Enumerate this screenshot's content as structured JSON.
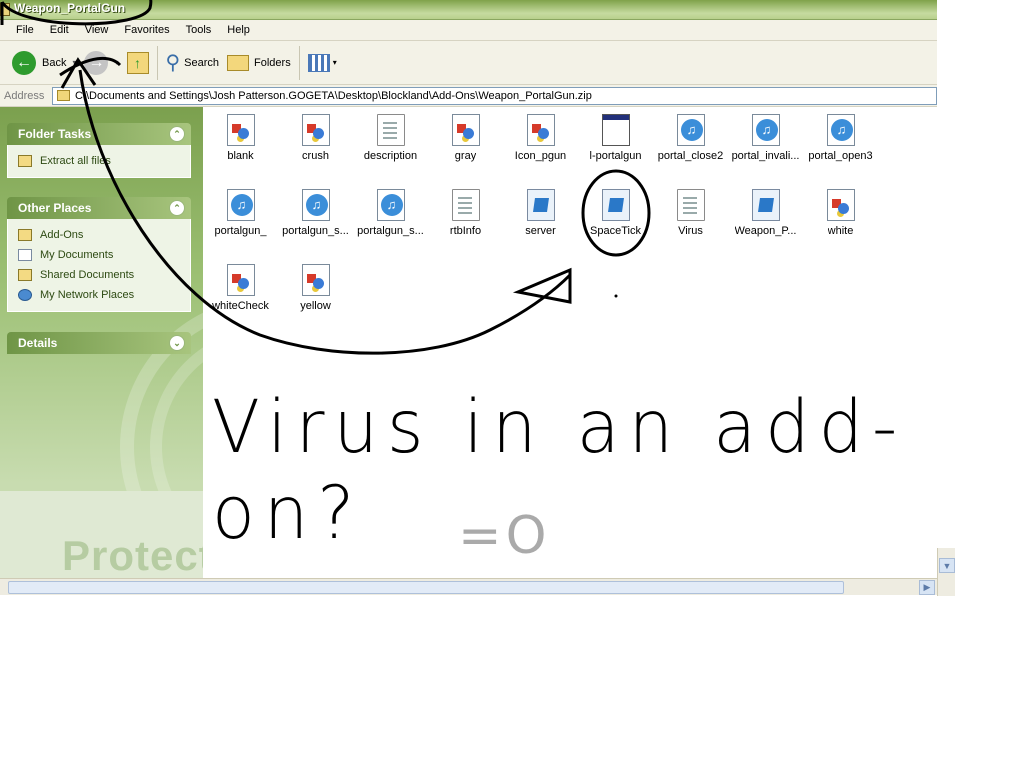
{
  "window": {
    "title": "Weapon_PortalGun"
  },
  "menu": [
    "File",
    "Edit",
    "View",
    "Favorites",
    "Tools",
    "Help"
  ],
  "toolbar": {
    "back": "Back",
    "search": "Search",
    "folders": "Folders"
  },
  "address": {
    "label": "Address",
    "path": "C:\\Documents and Settings\\Josh Patterson.GOGETA\\Desktop\\Blockland\\Add-Ons\\Weapon_PortalGun.zip"
  },
  "sidebar": {
    "folder_tasks": {
      "title": "Folder Tasks",
      "items": [
        "Extract all files"
      ]
    },
    "other_places": {
      "title": "Other Places",
      "items": [
        "Add-Ons",
        "My Documents",
        "Shared Documents",
        "My Network Places"
      ]
    },
    "details": {
      "title": "Details"
    },
    "watermark": "Protect"
  },
  "files": [
    {
      "name": "blank",
      "icon": "image-file-icon"
    },
    {
      "name": "crush",
      "icon": "image-file-icon"
    },
    {
      "name": "description",
      "icon": "text-document-icon"
    },
    {
      "name": "gray",
      "icon": "image-file-icon"
    },
    {
      "name": "Icon_pgun",
      "icon": "image-file-icon"
    },
    {
      "name": "l-portalgun",
      "icon": "executable-window-icon"
    },
    {
      "name": "portal_close2",
      "icon": "sound-file-icon"
    },
    {
      "name": "portal_invali...",
      "icon": "sound-file-icon"
    },
    {
      "name": "portal_open3",
      "icon": "sound-file-icon"
    },
    {
      "name": "portalgun_",
      "icon": "sound-file-icon"
    },
    {
      "name": "portalgun_s...",
      "icon": "sound-file-icon"
    },
    {
      "name": "portalgun_s...",
      "icon": "sound-file-icon"
    },
    {
      "name": "rtbInfo",
      "icon": "text-document-icon"
    },
    {
      "name": "server",
      "icon": "script-file-icon"
    },
    {
      "name": "SpaceTick",
      "icon": "script-file-icon"
    },
    {
      "name": "Virus",
      "icon": "text-document-icon"
    },
    {
      "name": "Weapon_P...",
      "icon": "script-file-icon"
    },
    {
      "name": "white",
      "icon": "image-file-icon"
    },
    {
      "name": "whiteCheck",
      "icon": "image-file-icon"
    },
    {
      "name": "yellow",
      "icon": "image-file-icon"
    }
  ],
  "annotation": {
    "text": "Virus in an add-on?",
    "face": "=O",
    "ink_color": "#000000",
    "face_color": "#aaaaaa"
  },
  "colors": {
    "sidebar_green": "#7ba04e",
    "titlebar_green": "#7fa24a",
    "toolbar_bg": "#f3f2e7"
  }
}
